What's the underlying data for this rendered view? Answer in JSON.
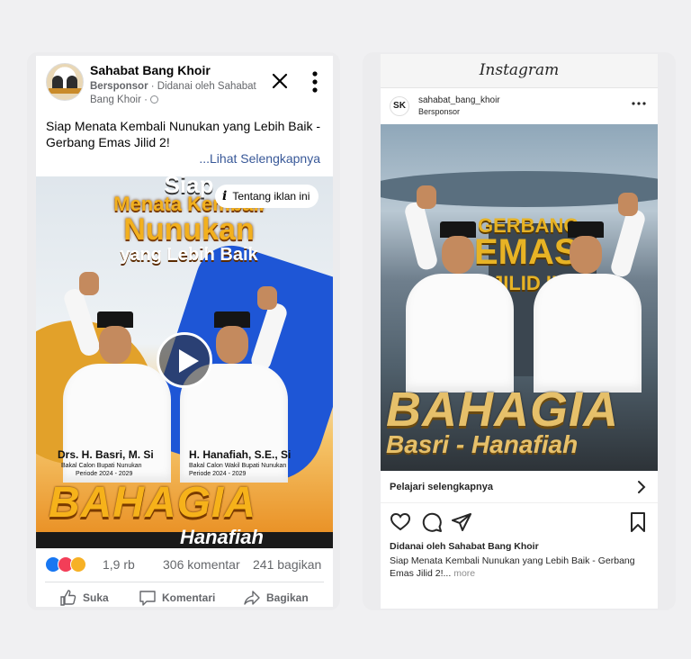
{
  "facebook": {
    "page_name": "Sahabat Bang Khoir",
    "sponsored_label": "Bersponsor",
    "funded_by": "· Didanai oleh Sahabat Bang Khoir ·",
    "caption": "Siap Menata Kembali Nunukan yang Lebih Baik - Gerbang Emas Jilid 2!",
    "see_more": "...Lihat Selengkapnya",
    "about_ad": "Tentang iklan ini",
    "media": {
      "headline_1": "Siap",
      "headline_2": "Menata Kembali",
      "headline_3": "Nunukan",
      "headline_4": "yang Lebih Baik",
      "candidate_1_name": "Drs. H. Basri, M. Si",
      "candidate_1_role": "Bakal Calon Bupati Nunukan",
      "candidate_1_period": "Periode 2024 - 2029",
      "candidate_2_name": "H. Hanafiah, S.E., Si",
      "candidate_2_role": "Bakal Calon Wakil Bupati Nunukan",
      "candidate_2_period": "Periode 2024 - 2029",
      "slogan": "BAHAGIA",
      "slogan_sub": "Hanafiah"
    },
    "reaction_count": "1,9 rb",
    "comments": "306 komentar",
    "shares": "241 bagikan",
    "actions": {
      "like": "Suka",
      "comment": "Komentari",
      "share": "Bagikan"
    },
    "colors": {
      "like": "#1877f2",
      "love": "#f33e58",
      "care": "#f7b125",
      "link": "#385898"
    }
  },
  "instagram": {
    "app_title": "Instagram",
    "avatar_text": "SK",
    "username": "sahabat_bang_khoir",
    "sponsored_label": "Bersponsor",
    "media": {
      "line_1": "GERBANG",
      "line_2": "EMAS",
      "line_3": "JILID II",
      "slogan": "BAHAGIA",
      "names": "Basri - Hanafiah"
    },
    "cta": "Pelajari selengkapnya",
    "funded_by": "Didanai oleh Sahabat Bang Khoir",
    "caption": "Siap Menata Kembali Nunukan yang Lebih Baik - Gerbang Emas Jilid 2!...",
    "more": "more"
  }
}
